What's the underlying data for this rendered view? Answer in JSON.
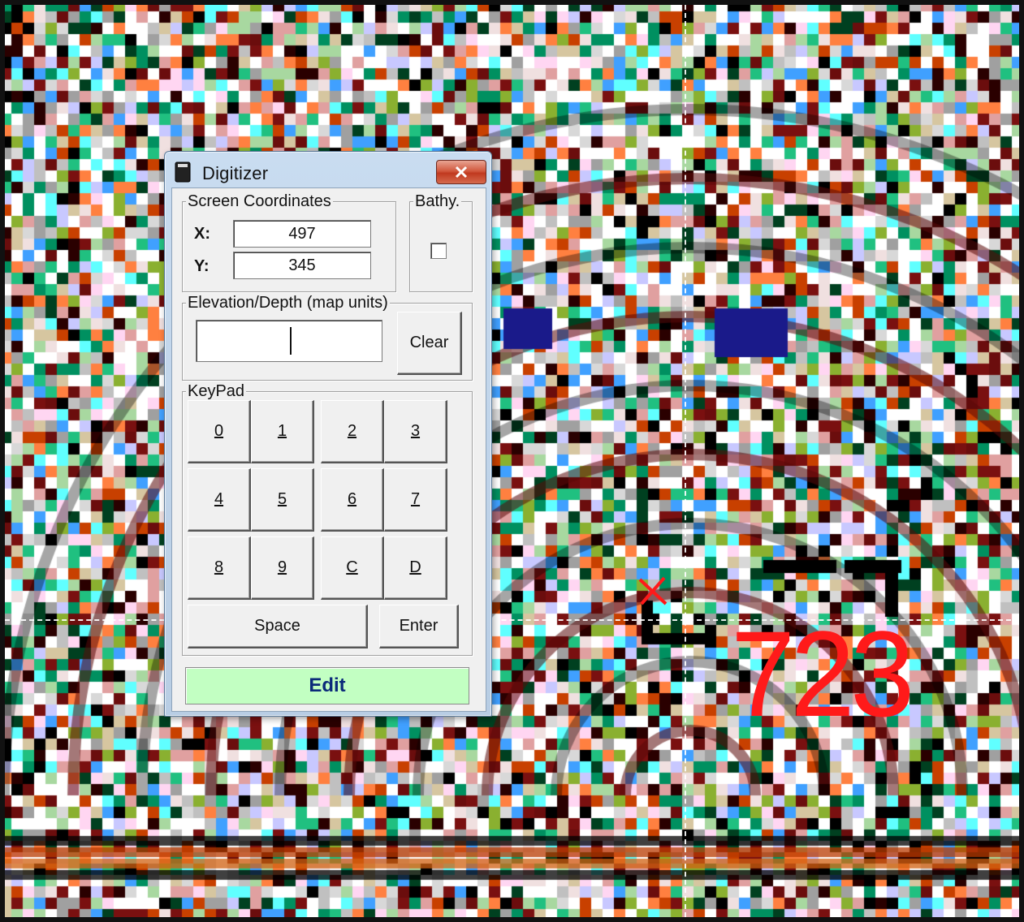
{
  "window": {
    "title": "Digitizer"
  },
  "screen_coordinates": {
    "group_label": "Screen Coordinates",
    "x_label": "X:",
    "x_value": "497",
    "y_label": "Y:",
    "y_value": "345"
  },
  "bathy": {
    "group_label": "Bathy.",
    "checked": false
  },
  "elevation": {
    "group_label": "Elevation/Depth (map units)",
    "value": "",
    "clear_label": "Clear"
  },
  "keypad": {
    "group_label": "KeyPad",
    "keys": [
      "0",
      "1",
      "2",
      "3",
      "4",
      "5",
      "6",
      "7",
      "8",
      "9",
      "C",
      "D"
    ],
    "space_label": "Space",
    "enter_label": "Enter"
  },
  "mode": {
    "label": "Edit",
    "color": "#c2ffc2"
  },
  "map": {
    "contour_label": "723",
    "label_color": "#ff1a1a"
  }
}
